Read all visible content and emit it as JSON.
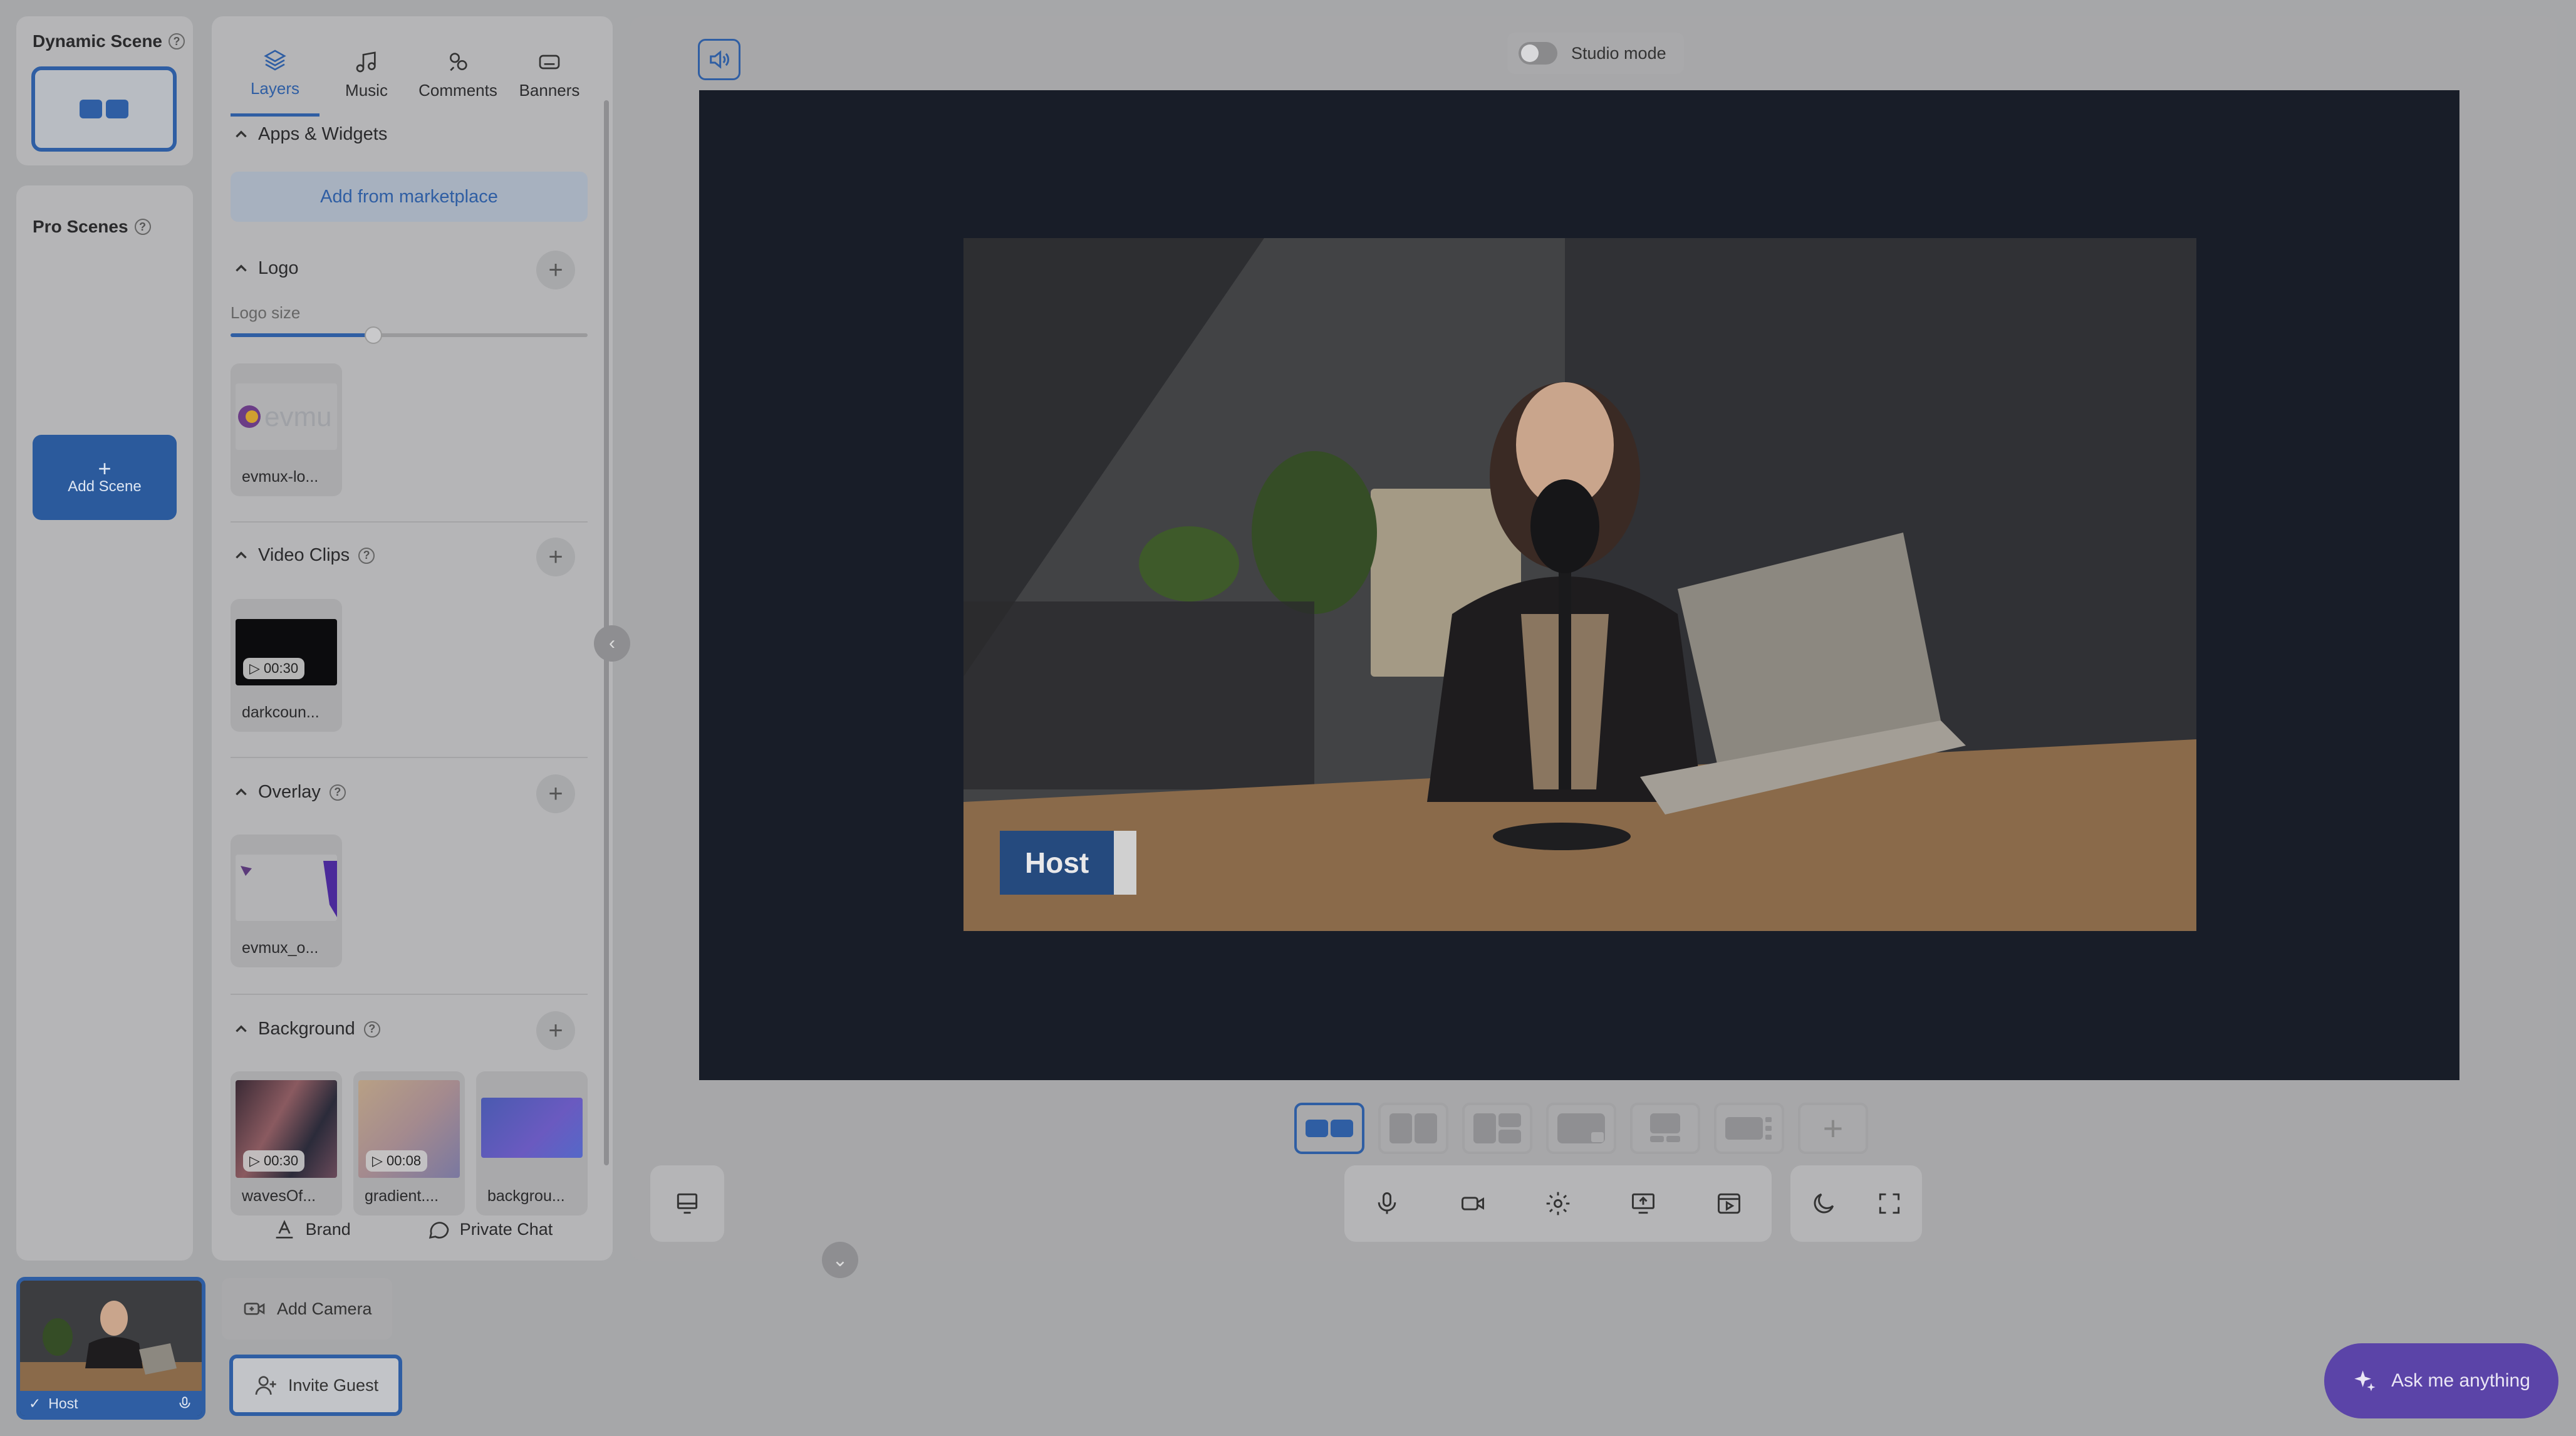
{
  "scenes": {
    "dynamic_title": "Dynamic Scene",
    "pro_title": "Pro Scenes",
    "add_scene": "Add Scene",
    "help_icon": "?"
  },
  "layers_panel": {
    "tabs": [
      {
        "label": "Layers",
        "icon": "layers-icon"
      },
      {
        "label": "Music",
        "icon": "music-icon"
      },
      {
        "label": "Comments",
        "icon": "comments-icon"
      },
      {
        "label": "Banners",
        "icon": "banners-icon"
      }
    ],
    "apps_widgets": {
      "title": "Apps & Widgets",
      "button": "Add from marketplace"
    },
    "logo": {
      "title": "Logo",
      "size_label": "Logo size",
      "size_value": 0.4,
      "items": [
        {
          "caption": "evmux-lo..."
        }
      ]
    },
    "video_clips": {
      "title": "Video Clips",
      "items": [
        {
          "caption": "darkcoun...",
          "duration": "00:30"
        }
      ]
    },
    "overlay": {
      "title": "Overlay",
      "items": [
        {
          "caption": "evmux_o..."
        }
      ]
    },
    "background": {
      "title": "Background",
      "items": [
        {
          "caption": "wavesOf...",
          "duration": "00:30"
        },
        {
          "caption": "gradient....",
          "duration": "00:08"
        },
        {
          "caption": "backgrou..."
        }
      ]
    },
    "footer": {
      "brand": "Brand",
      "private_chat": "Private Chat"
    }
  },
  "stage": {
    "studio_mode": "Studio mode",
    "host_label": "Host"
  },
  "bottom": {
    "camera_label": "Host",
    "add_camera": "Add Camera",
    "invite_guest": "Invite Guest",
    "ask": "Ask me anything"
  },
  "colors": {
    "accent": "#2f5ea3",
    "assistant": "#5b44a8",
    "stage_bg": "#181d28"
  }
}
